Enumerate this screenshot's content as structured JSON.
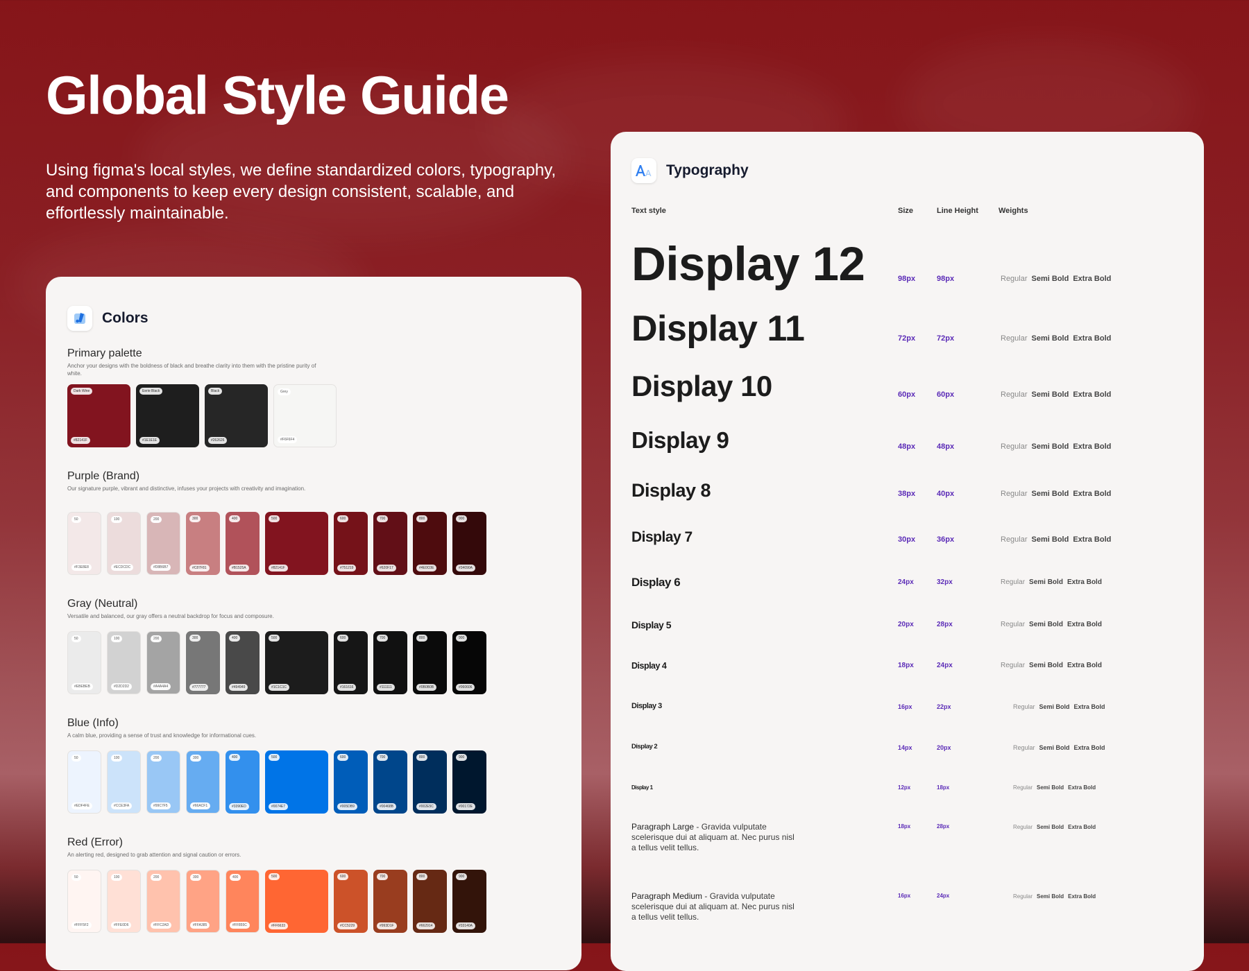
{
  "hero": {
    "title": "Global Style Guide",
    "description": "Using figma's local styles, we define standardized colors, typography, and components to keep every design consistent, scalable, and effortlessly maintainable."
  },
  "colors": {
    "title": "Colors",
    "icon": "color-palette-icon",
    "primary": {
      "title": "Primary palette",
      "desc": "Anchor your designs with the boldness of black and breathe clarity into them with the pristine purity of white.",
      "swatches": [
        {
          "name": "Dark Wine",
          "hex": "#82141F",
          "color": "#82141F"
        },
        {
          "name": "Eerie Black",
          "hex": "#1E1E1E",
          "color": "#1E1E1E"
        },
        {
          "name": "Black",
          "hex": "#262626",
          "color": "#262626"
        },
        {
          "name": "Grey",
          "hex": "#F6F6F4",
          "color": "#F6F6F4"
        }
      ]
    },
    "purple": {
      "title": "Purple (Brand)",
      "desc": "Our signature purple, vibrant and distinctive, infuses your projects with creativity and imagination.",
      "swatches": [
        {
          "name": "50",
          "hex": "#F3E8E8",
          "color": "#F3E8E8"
        },
        {
          "name": "100",
          "hex": "#ECDCDC",
          "color": "#ECDCDC"
        },
        {
          "name": "200",
          "hex": "#D8B6B7",
          "color": "#D8B6B7"
        },
        {
          "name": "300",
          "hex": "#C87F81",
          "color": "#C87F81"
        },
        {
          "name": "400",
          "hex": "#B1525A",
          "color": "#B1525A"
        },
        {
          "name": "500",
          "hex": "#82141F",
          "color": "#82141F"
        },
        {
          "name": "600",
          "hex": "#751219",
          "color": "#751219"
        },
        {
          "name": "700",
          "hex": "#620F17",
          "color": "#620F17"
        },
        {
          "name": "800",
          "hex": "#4E0C0E",
          "color": "#4E0C0E"
        },
        {
          "name": "900",
          "hex": "#34090A",
          "color": "#34090A"
        }
      ]
    },
    "gray": {
      "title": "Gray (Neutral)",
      "desc": "Versatile and balanced, our gray offers a neutral backdrop for focus and composure.",
      "swatches": [
        {
          "name": "50",
          "hex": "#EBEBEB",
          "color": "#EBEBEB"
        },
        {
          "name": "100",
          "hex": "#D2D2D2",
          "color": "#D2D2D2"
        },
        {
          "name": "200",
          "hex": "#A4A4A4",
          "color": "#A4A4A4"
        },
        {
          "name": "300",
          "hex": "#777777",
          "color": "#777777"
        },
        {
          "name": "400",
          "hex": "#494949",
          "color": "#494949"
        },
        {
          "name": "500",
          "hex": "#1C1C1C",
          "color": "#1C1C1C"
        },
        {
          "name": "600",
          "hex": "#161616",
          "color": "#161616"
        },
        {
          "name": "700",
          "hex": "#111111",
          "color": "#111111"
        },
        {
          "name": "800",
          "hex": "#0B0B0B",
          "color": "#0B0B0B"
        },
        {
          "name": "900",
          "hex": "#060606",
          "color": "#060606"
        }
      ]
    },
    "blue": {
      "title": "Blue (Info)",
      "desc": "A calm blue, providing a sense of trust and knowledge for informational cues.",
      "swatches": [
        {
          "name": "50",
          "hex": "#EDF4FE",
          "color": "#EDF4FE"
        },
        {
          "name": "100",
          "hex": "#CCE3FA",
          "color": "#CCE3FA"
        },
        {
          "name": "200",
          "hex": "#99C7F5",
          "color": "#99C7F5"
        },
        {
          "name": "300",
          "hex": "#66ACF1",
          "color": "#66ACF1"
        },
        {
          "name": "400",
          "hex": "#3390ED",
          "color": "#3390ED"
        },
        {
          "name": "500",
          "hex": "#0074E7",
          "color": "#0074E7"
        },
        {
          "name": "600",
          "hex": "#005DB9",
          "color": "#005DB9"
        },
        {
          "name": "700",
          "hex": "#00468B",
          "color": "#00468B"
        },
        {
          "name": "800",
          "hex": "#002E5C",
          "color": "#002E5C"
        },
        {
          "name": "900",
          "hex": "#00172E",
          "color": "#00172E"
        }
      ]
    },
    "red": {
      "title": "Red (Error)",
      "desc": "An alerting red, designed to grab attention and signal caution or errors.",
      "swatches": [
        {
          "name": "50",
          "hex": "#FFF5F2",
          "color": "#FFF5F2"
        },
        {
          "name": "100",
          "hex": "#FFE0D6",
          "color": "#FFE0D6"
        },
        {
          "name": "200",
          "hex": "#FFC2AD",
          "color": "#FFC2AD"
        },
        {
          "name": "300",
          "hex": "#FFA385",
          "color": "#FFA385"
        },
        {
          "name": "400",
          "hex": "#FF855C",
          "color": "#FF855C"
        },
        {
          "name": "500",
          "hex": "#FF6633",
          "color": "#FF6633"
        },
        {
          "name": "600",
          "hex": "#CC5229",
          "color": "#CC5229"
        },
        {
          "name": "700",
          "hex": "#993D1F",
          "color": "#993D1F"
        },
        {
          "name": "800",
          "hex": "#662914",
          "color": "#662914"
        },
        {
          "name": "900",
          "hex": "#33140A",
          "color": "#33140A"
        }
      ]
    }
  },
  "typography": {
    "title": "Typography",
    "icon": "text-style-icon",
    "headers": {
      "style": "Text style",
      "size": "Size",
      "line_height": "Line Height",
      "weights": "Weights"
    },
    "weights": {
      "regular": "Regular",
      "semibold": "Semi Bold",
      "extrabold": "Extra Bold"
    },
    "rows": [
      {
        "name": "Display 12",
        "size": "98px",
        "line_height": "98px"
      },
      {
        "name": "Display 11",
        "size": "72px",
        "line_height": "72px"
      },
      {
        "name": "Display 10",
        "size": "60px",
        "line_height": "60px"
      },
      {
        "name": "Display 9",
        "size": "48px",
        "line_height": "48px"
      },
      {
        "name": "Display 8",
        "size": "38px",
        "line_height": "40px"
      },
      {
        "name": "Display 7",
        "size": "30px",
        "line_height": "36px"
      },
      {
        "name": "Display 6",
        "size": "24px",
        "line_height": "32px"
      },
      {
        "name": "Display 5",
        "size": "20px",
        "line_height": "28px"
      },
      {
        "name": "Display 4",
        "size": "18px",
        "line_height": "24px"
      },
      {
        "name": "Display 3",
        "size": "16px",
        "line_height": "22px"
      },
      {
        "name": "Display 2",
        "size": "14px",
        "line_height": "20px"
      },
      {
        "name": "Display 1",
        "size": "12px",
        "line_height": "18px"
      }
    ],
    "paragraphs": [
      {
        "name": "Paragraph Large",
        "sample": " - Gravida vulputate scelerisque dui at aliquam at. Nec purus nisl a tellus velit tellus.",
        "size": "18px",
        "line_height": "28px"
      },
      {
        "name": "Paragraph Medium",
        "sample": " - Gravida vulputate scelerisque dui at aliquam at. Nec purus nisl a tellus velit tellus.",
        "size": "16px",
        "line_height": "24px"
      }
    ]
  }
}
